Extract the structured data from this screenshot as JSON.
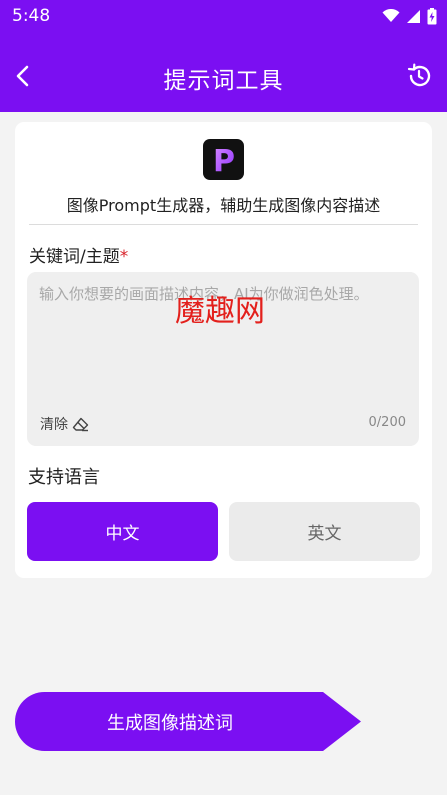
{
  "status_bar": {
    "time": "5:48",
    "icons": [
      "wifi-icon",
      "cellular-signal-icon",
      "battery-charging-icon"
    ]
  },
  "header": {
    "title": "提示词工具",
    "back_icon": "chevron-left-icon",
    "history_icon": "history-icon"
  },
  "tool": {
    "logo_letter": "P",
    "subtitle": "图像Prompt生成器，辅助生成图像内容描述"
  },
  "keyword_field": {
    "label": "关键词/主题",
    "required_mark": "*",
    "value": "",
    "placeholder": "输入你想要的画面描述内容，AI为你做润色处理。",
    "clear_label": "清除",
    "clear_icon": "eraser-icon",
    "counter": "0/200"
  },
  "watermark": "魔趣网",
  "language": {
    "label": "支持语言",
    "options": [
      {
        "label": "中文",
        "selected": true
      },
      {
        "label": "英文",
        "selected": false
      }
    ]
  },
  "actions": {
    "generate_label": "生成图像描述词"
  },
  "colors": {
    "primary": "#7b0ff2",
    "required": "#d8222a",
    "watermark": "#e3201c",
    "background": "#f3f3f3"
  }
}
